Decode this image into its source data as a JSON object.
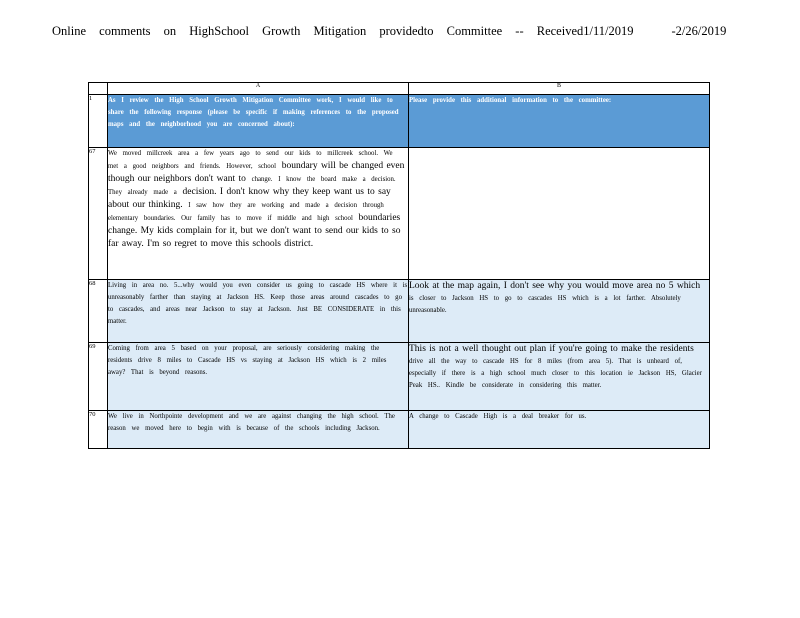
{
  "title": {
    "main": "Online comments on HighSchool Growth Mitigation providedto Committee -- Received1/11/2019",
    "range_end": "-2/26/2019"
  },
  "columns": [
    "A",
    "B"
  ],
  "header_row": {
    "num": "1",
    "a": "As I review the High School Growth Mitigation Committee work, I would like to share the following response (please be specific if making references to the proposed maps and the neighborhood you are concerned about):",
    "b": "Please provide this additional information to the committee:"
  },
  "rows": [
    {
      "num": "67",
      "a_parts": [
        "We moved millcreek area a few years ago to send our kids to millcreek school. We met a good neighbors and friends. However, school",
        "boundary will be changed even though our neighbors don't want to",
        "change. I know the board make a decision. They already made a",
        "decision. I don't know why they keep want us to say about our thinking.",
        "I saw how they are working and made a decision through elementary boundaries. Our family has to move if middle and high school",
        "boundaries change. My kids complain for it, but we don't want to send our kids to so far away. I'm so regret to move this schools district."
      ],
      "b": ""
    },
    {
      "num": "68",
      "a": "Living in area no. 5...why would you even consider us going to cascade HS where it is unreasonably farther than staying at Jackson HS. Keep those areas around cascades to go to cascades, and areas near Jackson to stay at Jackson. Just BE CONSIDERATE in this matter.",
      "b_parts": [
        "Look at the map again, I don't see why you would move area no 5 which",
        "is closer to Jackson HS to go to cascades HS which is a lot farther. Absolutely unreasonable."
      ]
    },
    {
      "num": "69",
      "a": "Coming from area 5 based on your proposal, are seriously considering making the residents drive 8 miles to Cascade HS vs staying at Jackson HS which is 2 miles away? That is beyond reasons.",
      "b_parts": [
        "This is not a well thought out plan if you're going to make the residents",
        "drive all the way to cascade HS for 8 miles (from area 5). That is unheard of, especially if there is a high school much closer to this location ie Jackson HS, Glacier Peak HS.. Kindle be considerate in considering this matter."
      ]
    },
    {
      "num": "70",
      "a": "We live in Northpointe development and we are against changing the high school. The reason we moved here to begin with is because of the schools including Jackson.",
      "b": "A change to Cascade High is a deal breaker for us."
    }
  ]
}
